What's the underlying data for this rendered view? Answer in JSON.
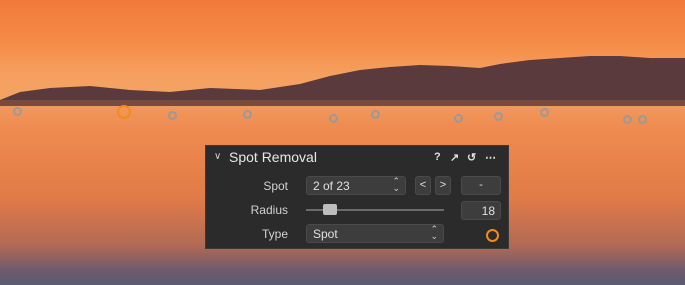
{
  "panel": {
    "title": "Spot Removal",
    "header_icons": {
      "help": "?",
      "expand": "↗",
      "reset": "↺",
      "more": "⋯"
    },
    "spot": {
      "label": "Spot",
      "value": "2 of 23",
      "prev": "<",
      "next": ">",
      "delete": "-"
    },
    "radius": {
      "label": "Radius",
      "value": "18"
    },
    "type": {
      "label": "Type",
      "value": "Spot"
    }
  },
  "colors": {
    "accent": "#f28a1e",
    "spot_marker": "#9a9a9a",
    "panel_bg": "#2b2b2b"
  }
}
